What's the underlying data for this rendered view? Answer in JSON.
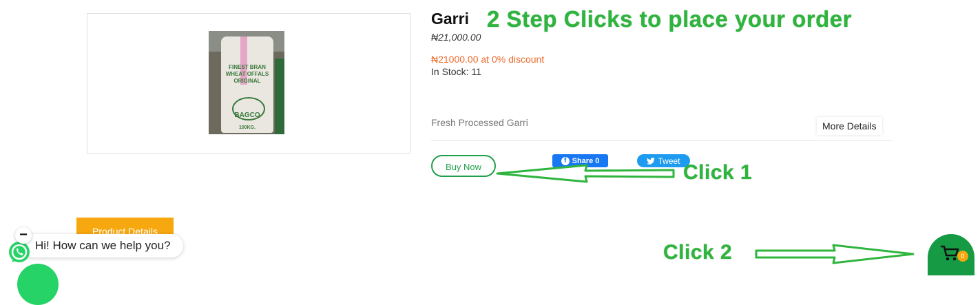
{
  "product": {
    "title": "Garri",
    "price": "₦21,000.00",
    "discount_text": "₦21000.00 at 0% discount",
    "stock_text": "In Stock: 11",
    "description": "Fresh Processed Garri",
    "image_text": {
      "line1": "FINEST BRAN",
      "line2": "WHEAT OFFALS",
      "line3": "ORIGINAL",
      "brand": "BAGCO",
      "weight": "100KG."
    }
  },
  "overlay": {
    "headline": "2 Step Clicks to place your order",
    "click1": "Click 1",
    "click2": "Click 2"
  },
  "actions": {
    "buy_now": "Buy Now",
    "more_details": "More Details",
    "fb_share": "Share 0",
    "tweet": "Tweet",
    "product_details_tab": "Product Details"
  },
  "chat": {
    "greeting": "Hi! How can we help you?",
    "minimize": "−"
  },
  "cart": {
    "count": "0"
  },
  "colors": {
    "accent_green": "#2fb53e",
    "buy_green": "#1f9f4a",
    "discount_orange": "#ef6a2a",
    "tab_orange": "#f7a80e",
    "facebook_blue": "#1877f2",
    "twitter_blue": "#1d9bf0"
  }
}
